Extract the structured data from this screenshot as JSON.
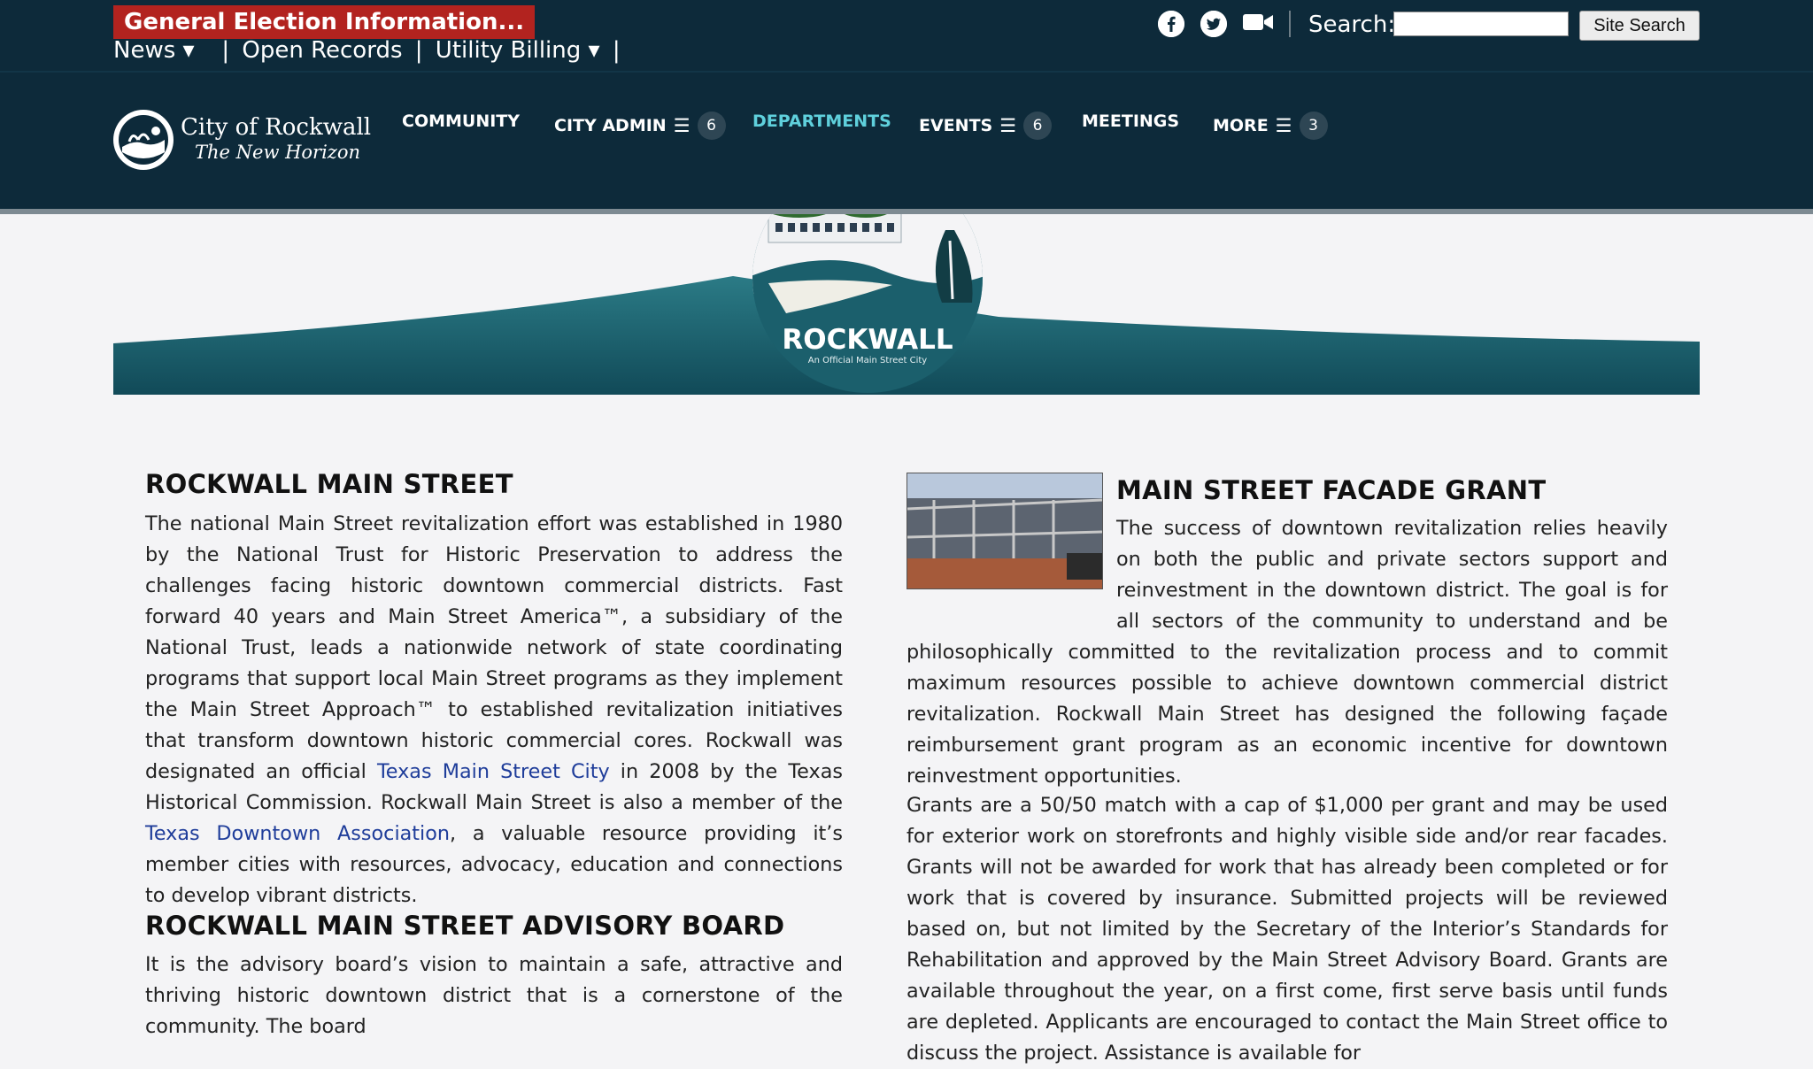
{
  "topbar": {
    "alert": "General Election Information...",
    "nav": [
      {
        "label": "News ▾"
      },
      {
        "label": "Open Records"
      },
      {
        "label": "Utility Billing ▾"
      }
    ],
    "search_label": "Search:",
    "search_placeholder": "",
    "search_button": "Site Search",
    "social_icons": [
      "facebook-icon",
      "twitter-icon",
      "video-camera-icon"
    ]
  },
  "logo": {
    "name": "City of Rockwall",
    "tagline": "The New Horizon"
  },
  "mainnav": {
    "items": [
      {
        "label": "COMMUNITY"
      },
      {
        "label": "CITY ADMIN",
        "count": "6"
      },
      {
        "label": "DEPARTMENTS",
        "active": true
      },
      {
        "label": "EVENTS",
        "count": "6"
      },
      {
        "label": "MEETINGS"
      },
      {
        "label": "MORE",
        "count": "3"
      }
    ]
  },
  "banner": {
    "title": "ROCKWALL",
    "subtitle": "An Official Main Street City"
  },
  "left": {
    "heading1": "ROCKWALL MAIN STREET",
    "para1": {
      "part1": "The national Main Street revitalization effort was established in 1980 by the National Trust for Historic Preservation to address the challenges facing historic downtown commercial districts. Fast forward 40 years and Main Street America™, a subsidiary of the National Trust, leads a nationwide network of state coordinating programs that support local Main Street programs as they implement the Main Street Approach™ to established revitalization initiatives that transform downtown historic commercial cores. Rockwall was designated an official ",
      "link1": "Texas Main Street City",
      "part2": " in 2008 by the Texas Historical Commission. Rockwall Main Street is also a member of the ",
      "link2": "Texas Downtown Association",
      "part3": ", a valuable resource providing it’s member cities with resources, advocacy, education and connections to develop vibrant districts."
    },
    "heading2": "ROCKWALL MAIN STREET ADVISORY BOARD",
    "para2": "It is the advisory board’s vision to maintain a safe, attractive and thriving historic downtown district that is a cornerstone of the community. The board"
  },
  "right": {
    "heading": "MAIN STREET FACADE GRANT",
    "para1": "The success of downtown revitalization relies heavily on both the public and private sectors support and reinvestment in the downtown district. The goal is for all sectors of the community to understand and be philosophically committed to the revitalization process and to commit maximum resources possible to achieve downtown commercial district revitalization. Rockwall Main Street has designed the following façade reimbursement grant program as an economic incentive for downtown reinvestment opportunities.",
    "para2": "Grants are a 50/50 match with a cap of $1,000 per grant and may be used for exterior work on storefronts and highly visible side and/or rear facades. Grants will not be awarded for work that has already been completed or for work that is covered by insurance. Submitted projects will be reviewed based on, but not limited by the Secretary of the Interior’s Standards for Rehabilitation and approved by the Main Street Advisory Board. Grants are available throughout the year, on a first come, first serve basis until funds are depleted. Applicants are encouraged to contact the Main Street office to discuss the project. Assistance is available for"
  },
  "colors": {
    "nav_bg": "#0d2a3a",
    "alert_bg": "#b2231f",
    "active_nav": "#5fd0dc",
    "banner_teal": "#1b5f6c",
    "link": "#1f3d9a"
  }
}
